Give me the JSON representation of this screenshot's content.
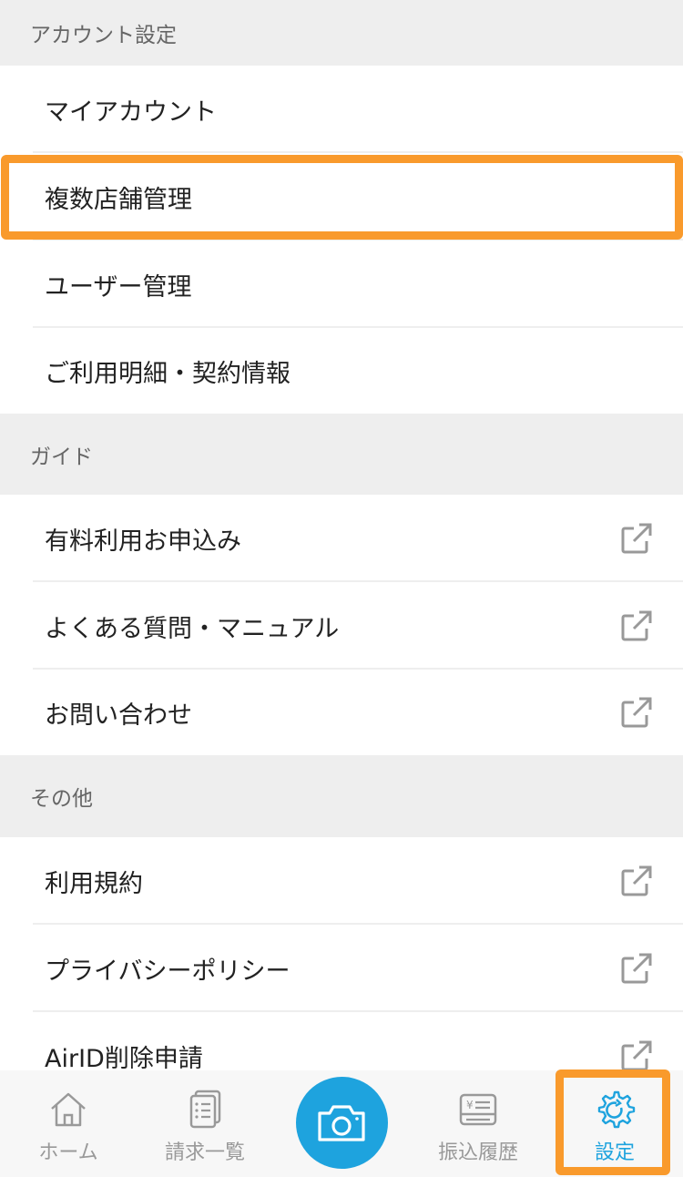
{
  "sections": {
    "account": {
      "header": "アカウント設定",
      "items": [
        "マイアカウント",
        "複数店舗管理",
        "ユーザー管理",
        "ご利用明細・契約情報"
      ]
    },
    "guide": {
      "header": "ガイド",
      "items": [
        "有料利用お申込み",
        "よくある質問・マニュアル",
        "お問い合わせ"
      ]
    },
    "other": {
      "header": "その他",
      "items": [
        "利用規約",
        "プライバシーポリシー",
        "AirID削除申請"
      ]
    }
  },
  "tabbar": {
    "home": "ホーム",
    "invoices": "請求一覧",
    "camera_icon": "camera-icon",
    "transfers": "振込履歴",
    "settings": "設定"
  },
  "colors": {
    "accent": "#1ea3de",
    "highlight": "#f99a2c",
    "section_bg": "#eeeeee"
  },
  "icons": {
    "external_link": "external-link-icon"
  }
}
